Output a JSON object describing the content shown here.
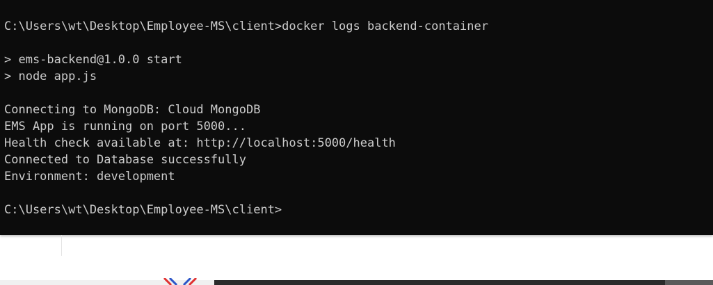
{
  "terminal": {
    "lines": [
      "C:\\Users\\wt\\Desktop\\Employee-MS\\client>docker logs backend-container",
      "",
      "> ems-backend@1.0.0 start",
      "> node app.js",
      "",
      "Connecting to MongoDB: Cloud MongoDB",
      "EMS App is running on port 5000...",
      "Health check available at: http://localhost:5000/health",
      "Connected to Database successfully",
      "Environment: development",
      "",
      "C:\\Users\\wt\\Desktop\\Employee-MS\\client>"
    ]
  },
  "colors": {
    "terminal_background": "#0c0c0c",
    "terminal_text": "#cccccc",
    "logo_blue": "#2b55c8",
    "logo_red": "#e03030"
  },
  "icons": {
    "bottom_logo": "partial-logo-icon"
  }
}
